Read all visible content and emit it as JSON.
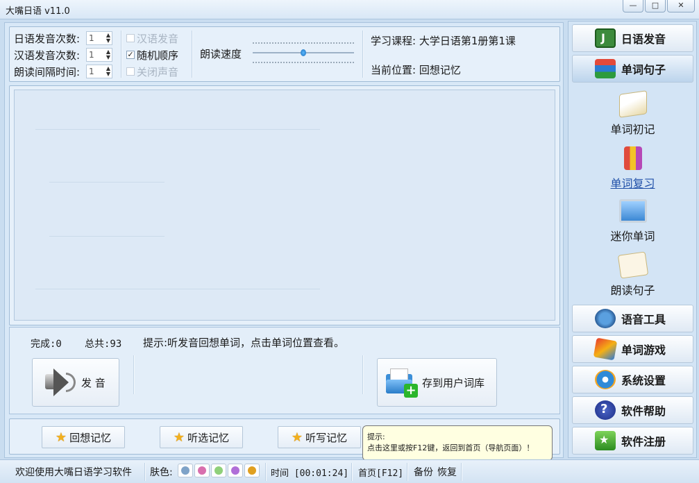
{
  "window": {
    "title": "大嘴日语 v11.0",
    "btn_min": "—",
    "btn_max": "□",
    "btn_close": "✕"
  },
  "settings": {
    "jp_count_label": "日语发音次数:",
    "jp_count_value": "1",
    "cn_count_label": "汉语发音次数:",
    "cn_count_value": "1",
    "interval_label": "朗读间隔时间:",
    "interval_value": "1",
    "chk_cn_pron": "汉语发音",
    "chk_random": "随机顺序",
    "chk_mute": "关闭声音",
    "speed_label": "朗读速度",
    "speed_level": 0.5,
    "course": "学习课程: 大学日语第1册第1课",
    "position": "当前位置: 回想记忆"
  },
  "control": {
    "done": "完成:0",
    "total": "总共:93",
    "hint": "提示:听发音回想单词，点击单词位置查看。",
    "speak_button": "发 音",
    "save_button": "存到用户词库"
  },
  "modes": {
    "recall": "回想记忆",
    "choose": "听选记忆",
    "write": "听写记忆"
  },
  "tooltip": {
    "line1": "提示:",
    "line2": "点击这里或按F12键，返回到首页（导航页面）！"
  },
  "nav": {
    "jp_pron": "日语发音",
    "words": "单词句子",
    "sub": {
      "first": "单词初记",
      "review": "单词复习",
      "mini": "迷你单词",
      "read": "朗读句子"
    },
    "tools": "语音工具",
    "game": "单词游戏",
    "settings": "系统设置",
    "help": "软件帮助",
    "register": "软件注册"
  },
  "status": {
    "welcome": "欢迎使用大嘴日语学习软件",
    "skin_label": "肤色:",
    "skin_colors": [
      "#7fa3c8",
      "#d86fae",
      "#8fd07a",
      "#b06fd8",
      "#e0a020"
    ],
    "time": "时间 [00:01:24]",
    "home": "首页[F12]",
    "backup": "备份",
    "restore": "恢复"
  }
}
